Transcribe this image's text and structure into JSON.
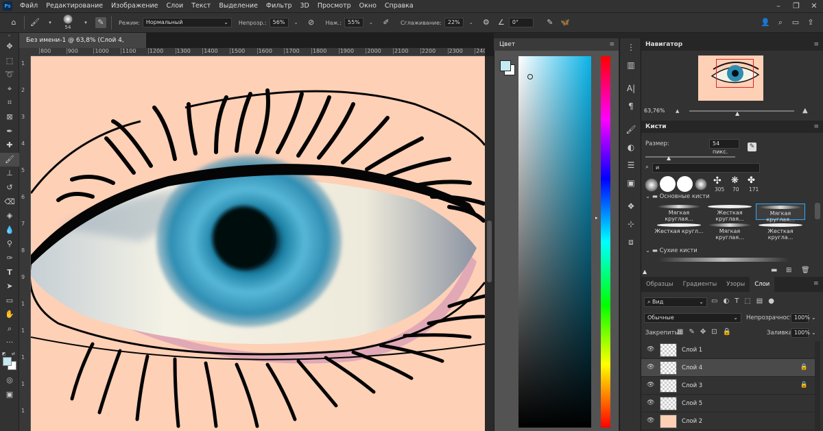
{
  "app": {
    "logo": "Ps"
  },
  "menu": [
    "Файл",
    "Редактирование",
    "Изображение",
    "Слои",
    "Текст",
    "Выделение",
    "Фильтр",
    "3D",
    "Просмотр",
    "Окно",
    "Справка"
  ],
  "options": {
    "brush_size": "54",
    "mode_label": "Режим:",
    "mode_value": "Нормальный",
    "opacity_label": "Непрозр.:",
    "opacity_value": "56%",
    "flow_label": "Наж.:",
    "flow_value": "55%",
    "smoothing_label": "Сглаживание:",
    "smoothing_value": "22%",
    "angle_value": "0°"
  },
  "document": {
    "tab_title": "Без имени-1 @ 63,8% (Слой 4, RGB/8) *",
    "ruler_ticks": [
      "800",
      "900",
      "1000",
      "1100",
      "1200",
      "1300",
      "1400",
      "1500",
      "1600",
      "1700",
      "1800",
      "1900",
      "2000",
      "2100",
      "2200",
      "2300",
      "240"
    ],
    "ruler_v_ticks": [
      "1",
      "2",
      "3",
      "4",
      "5",
      "6",
      "7",
      "8",
      "9",
      "1",
      "1",
      "1",
      "1",
      "1"
    ]
  },
  "color_panel": {
    "title": "Цвет",
    "foreground": "#c5eaf2",
    "background": "#ffffff",
    "hue_accent": "#0ab3e8"
  },
  "navigator": {
    "title": "Навигатор",
    "zoom": "63,76%"
  },
  "brushes": {
    "title": "Кисти",
    "size_label": "Размер:",
    "size_value": "54 пикс.",
    "search_value": "и",
    "preset_counts": [
      "305",
      "70",
      "171"
    ],
    "group1": "Основные кисти",
    "items": [
      "Мягкая круглая...",
      "Жесткая круглая...",
      "Мягкая круглая...",
      "Жесткая кругл...",
      "Мягкая круглая...",
      "Жесткая кругла..."
    ],
    "group2": "Сухие кисти"
  },
  "layers_panel": {
    "tabs": [
      "Образцы",
      "Градиенты",
      "Узоры",
      "Слои"
    ],
    "filter_value": "Вид",
    "blend_value": "Обычные",
    "opacity_label": "Непрозрачность:",
    "opacity_value": "100%",
    "lock_label": "Закрепить:",
    "fill_label": "Заливка:",
    "fill_value": "100%",
    "layers": [
      {
        "name": "Слой 1",
        "locked": false,
        "selected": false
      },
      {
        "name": "Слой 4",
        "locked": true,
        "selected": true
      },
      {
        "name": "Слой 3",
        "locked": true,
        "selected": false
      },
      {
        "name": "Слой 5",
        "locked": false,
        "selected": false
      },
      {
        "name": "Слой 2",
        "locked": false,
        "selected": false
      }
    ]
  }
}
